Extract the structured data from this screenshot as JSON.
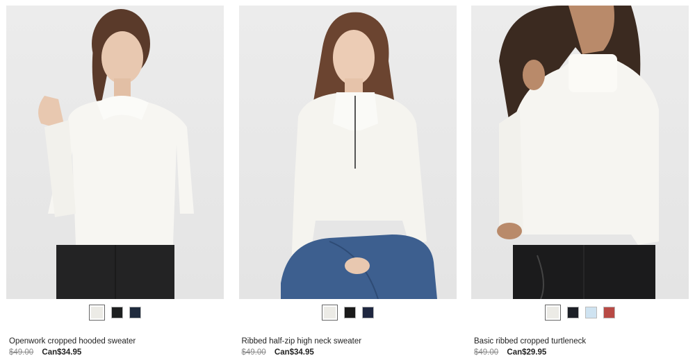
{
  "products": [
    {
      "name": "Openwork cropped hooded sweater",
      "original_price": "$49.00",
      "sale_price": "Can$34.95",
      "swatches": [
        {
          "color": "#ecebe6",
          "selected": true
        },
        {
          "color": "#1d1f20",
          "selected": false
        },
        {
          "color": "#1f2b3d",
          "selected": false
        }
      ]
    },
    {
      "name": "Ribbed half-zip high neck sweater",
      "original_price": "$49.00",
      "sale_price": "Can$34.95",
      "swatches": [
        {
          "color": "#ecebe6",
          "selected": true
        },
        {
          "color": "#1a1a1a",
          "selected": false
        },
        {
          "color": "#1f2740",
          "selected": false
        }
      ]
    },
    {
      "name": "Basic ribbed cropped turtleneck",
      "original_price": "$49.00",
      "sale_price": "Can$29.95",
      "swatches": [
        {
          "color": "#ecebe6",
          "selected": true
        },
        {
          "color": "#1c1f26",
          "selected": false
        },
        {
          "color": "#cfe3f1",
          "selected": false
        },
        {
          "color": "#b84a45",
          "selected": false
        }
      ]
    }
  ]
}
